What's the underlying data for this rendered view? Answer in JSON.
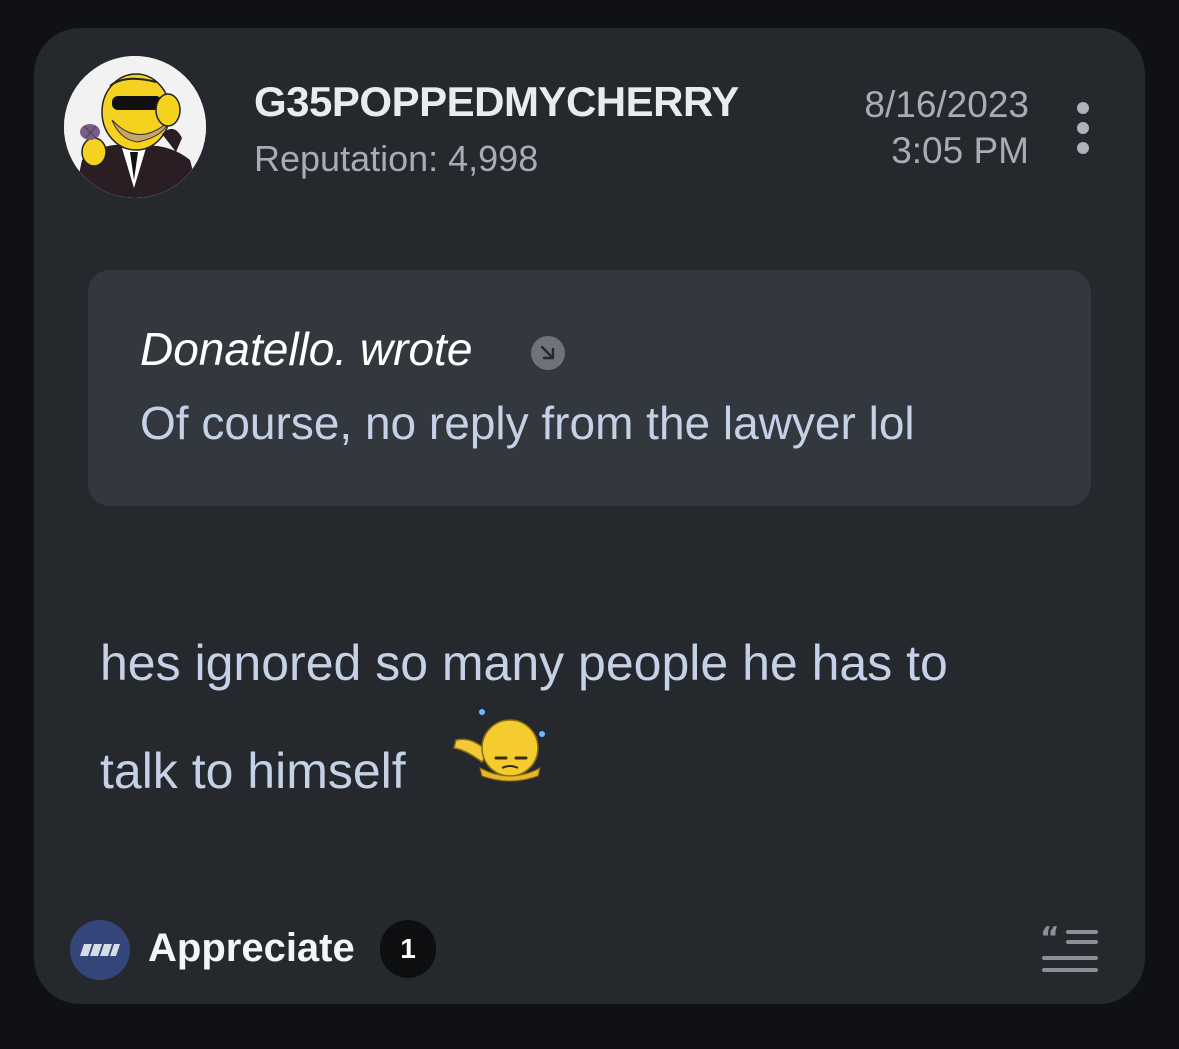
{
  "post": {
    "author": {
      "username": "G35POPPEDMYCHERRY",
      "reputation": "Reputation: 4,998",
      "avatar": "homer-simpson-avatar"
    },
    "date": "8/16/2023",
    "time": "3:05 PM",
    "quote": {
      "author_line": "Donatello. wrote",
      "text": "Of course, no reply from the lawyer lol"
    },
    "body": {
      "line1": "hes ignored so many people he has to",
      "line2": "talk to himself",
      "emoji": "sweating-sad-emoji"
    },
    "footer": {
      "appreciate_label": "Appreciate",
      "appreciate_count": "1",
      "icons": [
        "appreciate-icon",
        "quote-reply-icon",
        "more-options-icon"
      ]
    }
  },
  "colors": {
    "page_background": "#0f1114",
    "card_background": "#25282d",
    "quote_background": "#33373e",
    "body_text": "#c4d1e6",
    "appreciate_accent": "#35467a"
  }
}
